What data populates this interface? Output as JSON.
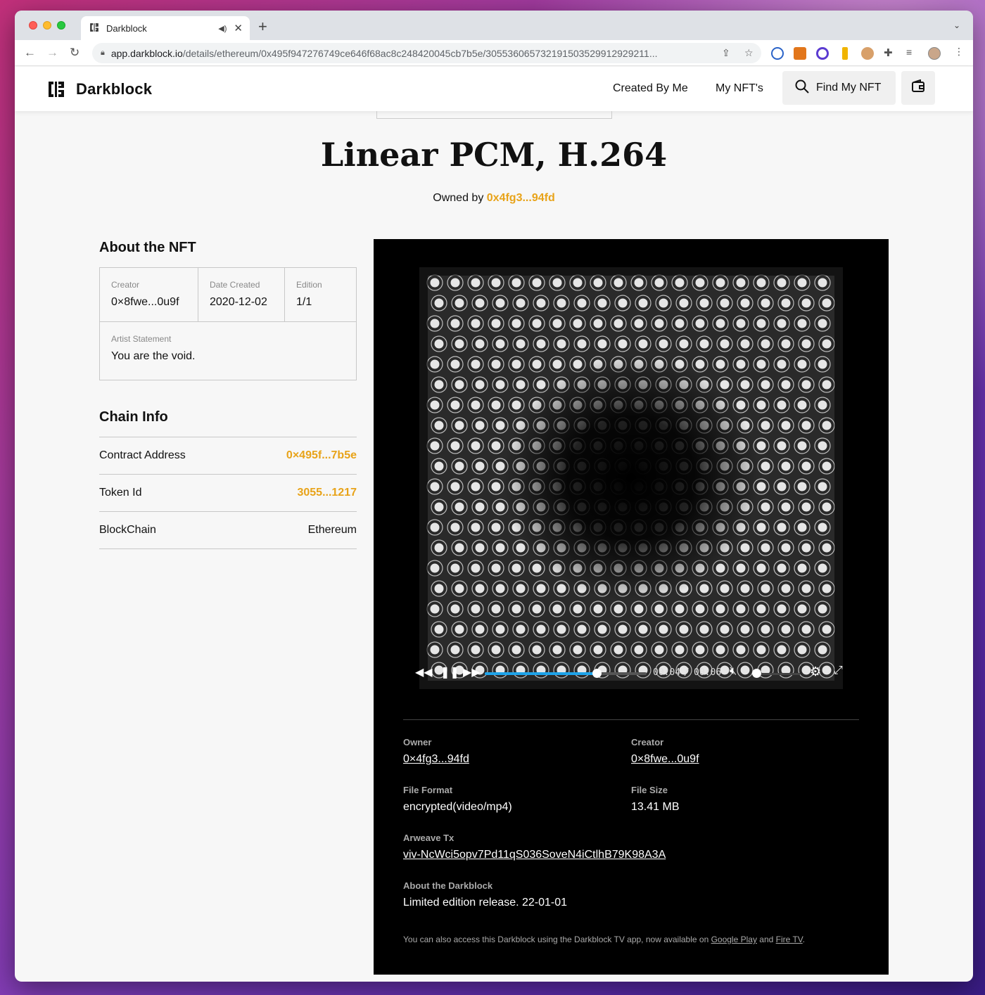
{
  "browser": {
    "tab_title": "Darkblock",
    "url_host": "app.darkblock.io",
    "url_path": "/details/ethereum/0x495f947276749ce646f68ac8c248420045cb7b5e/305536065732191503529912929211..."
  },
  "header": {
    "brand": "Darkblock",
    "nav_created": "Created By Me",
    "nav_mynfts": "My NFT's",
    "find_label": "Find My NFT"
  },
  "nft": {
    "title": "Linear PCM, H.264",
    "owned_by_label": "Owned by",
    "owner_short": "0x4fg3...94fd"
  },
  "about": {
    "heading": "About the NFT",
    "creator_label": "Creator",
    "creator_value": "0×8fwe...0u9f",
    "date_label": "Date Created",
    "date_value": "2020-12-02",
    "edition_label": "Edition",
    "edition_value": "1/1",
    "statement_label": "Artist Statement",
    "statement_value": "You are the void."
  },
  "chain": {
    "heading": "Chain Info",
    "rows": [
      {
        "label": "Contract Address",
        "value": "0×495f...7b5e"
      },
      {
        "label": "Token Id",
        "value": "3055...1217"
      },
      {
        "label": "BlockChain",
        "value": "Ethereum"
      }
    ]
  },
  "player": {
    "progress": 0.69,
    "current_time": "00:04",
    "separator": "/",
    "duration": "00:06",
    "volume": 0.0
  },
  "details": {
    "owner_label": "Owner",
    "owner_value": "0×4fg3...94fd",
    "creator_label": "Creator",
    "creator_value": "0×8fwe...0u9f",
    "format_label": "File Format",
    "format_value": "encrypted(video/mp4)",
    "size_label": "File Size",
    "size_value": "13.41 MB",
    "arweave_label": "Arweave Tx",
    "arweave_value": "viv-NcWci5opv7Pd11qS036SoveN4iCtlhB79K98A3A",
    "about_label": "About the Darkblock",
    "about_value": "Limited edition release. 22-01-01",
    "footnote_pre": "You can also access this Darkblock using the Darkblock TV app, now available on ",
    "footnote_link1": "Google Play",
    "footnote_mid": " and ",
    "footnote_link2": "Fire TV",
    "footnote_post": "."
  },
  "colors": {
    "accent_gold": "#e8a319",
    "progress_blue": "#1ea3e9"
  }
}
